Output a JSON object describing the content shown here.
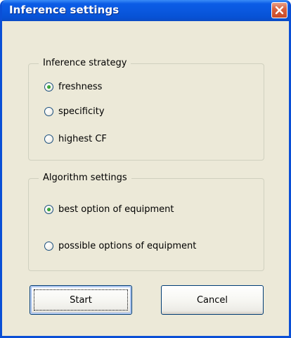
{
  "window": {
    "title": "Inference settings"
  },
  "strategy_group": {
    "label": "Inference strategy",
    "options": [
      {
        "label": "freshness",
        "checked": true
      },
      {
        "label": "specificity",
        "checked": false
      },
      {
        "label": "highest CF",
        "checked": false
      }
    ]
  },
  "algorithm_group": {
    "label": "Algorithm settings",
    "options": [
      {
        "label": "best option of equipment",
        "checked": true
      },
      {
        "label": "possible options of equipment",
        "checked": false
      }
    ]
  },
  "buttons": {
    "start_label": "Start",
    "cancel_label": "Cancel"
  },
  "colors": {
    "titlebar": "#0a58df",
    "dialog_bg": "#ece9d8",
    "radio_dot": "#21a121",
    "close_button": "#d8613f"
  }
}
